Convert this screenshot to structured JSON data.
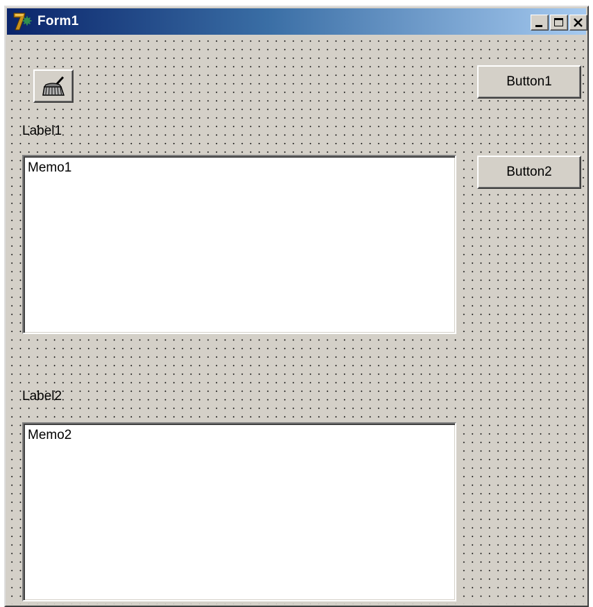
{
  "window": {
    "title": "Form1",
    "icon": "delphi-7-app-icon",
    "caption_buttons": [
      "minimize-icon",
      "maximize-icon",
      "close-icon"
    ]
  },
  "toolbar": {
    "speed_button_icon": "clear-broom-icon"
  },
  "buttons": {
    "button1_label": "Button1",
    "button2_label": "Button2"
  },
  "labels": {
    "label1": "Label1",
    "label2": "Label2"
  },
  "memos": {
    "memo1_text": "Memo1",
    "memo2_text": "Memo2"
  },
  "colors": {
    "face": "#d4d0c8",
    "title_gradient_start": "#0a246a",
    "title_gradient_end": "#a6caf0",
    "memo_background": "#ffffff"
  }
}
